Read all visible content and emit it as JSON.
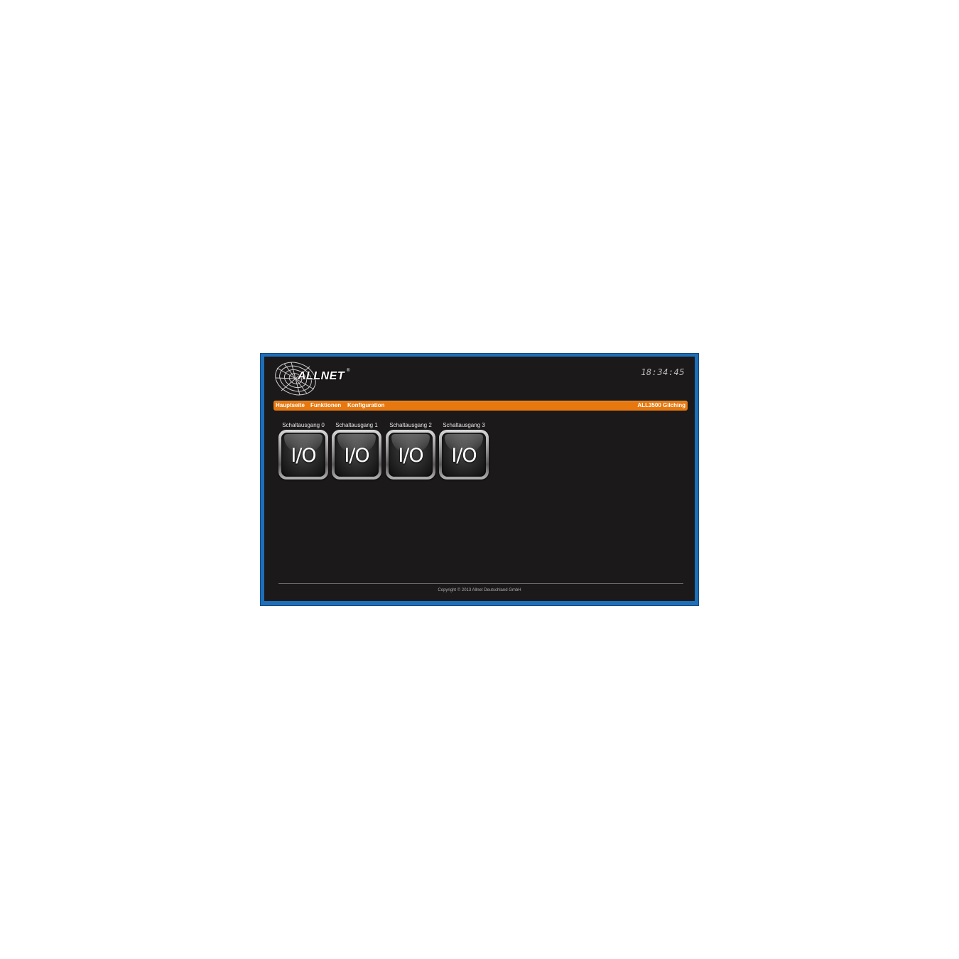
{
  "header": {
    "logo_text": "ALLNET",
    "logo_mark": "®",
    "clock": "18:34:45"
  },
  "nav": {
    "items": [
      {
        "label": "Hauptseite"
      },
      {
        "label": "Funktionen"
      },
      {
        "label": "Konfiguration"
      }
    ],
    "device_name": "ALL3500 Gilching"
  },
  "outputs": [
    {
      "label": "Schaltausgang 0",
      "button_text": "I/O"
    },
    {
      "label": "Schaltausgang 1",
      "button_text": "I/O"
    },
    {
      "label": "Schaltausgang 2",
      "button_text": "I/O"
    },
    {
      "label": "Schaltausgang 3",
      "button_text": "I/O"
    }
  ],
  "footer": {
    "copyright": "Copyright © 2013 Allnet Deutschland GmbH"
  },
  "colors": {
    "frame": "#1f6fb8",
    "background": "#1b191a",
    "nav_accent": "#e6780f"
  }
}
